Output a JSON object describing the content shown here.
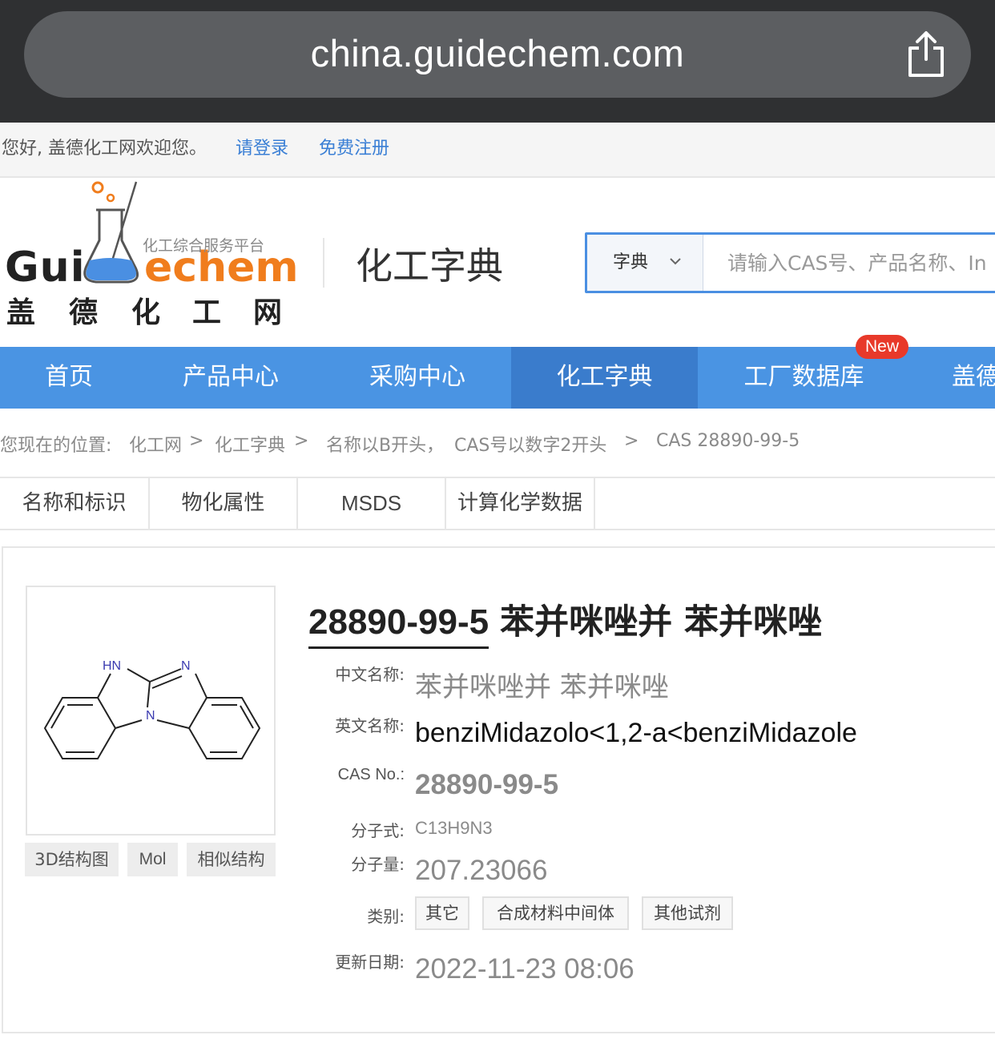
{
  "browser": {
    "url": "china.guidechem.com"
  },
  "welcome": {
    "text": "您好, 盖德化工网欢迎您。",
    "login": "请登录",
    "register": "免费注册"
  },
  "logo": {
    "brand_left": "Gui",
    "brand_right": "echem",
    "tagline": "化工综合服务平台",
    "chars": [
      "盖",
      "德",
      "化",
      "工",
      "网"
    ]
  },
  "header": {
    "title": "化工字典"
  },
  "search": {
    "select": "字典",
    "placeholder": "请输入CAS号、产品名称、In"
  },
  "nav": {
    "items": [
      "首页",
      "产品中心",
      "采购中心",
      "化工字典",
      "工厂数据库",
      "盖德"
    ],
    "active": "化工字典",
    "badge": "New"
  },
  "breadcrumb": {
    "prefix": "您现在的位置:",
    "items": [
      "化工网",
      "化工字典",
      "名称以B开头，",
      "CAS号以数字2开头",
      "CAS 28890-99-5"
    ],
    "sep": ">"
  },
  "tabs": [
    "名称和标识",
    "物化属性",
    "MSDS",
    "计算化学数据"
  ],
  "structure": {
    "atoms": {
      "hn": "HN",
      "n1": "N",
      "n2": "N"
    },
    "buttons": [
      "3D结构图",
      "Mol",
      "相似结构"
    ]
  },
  "compound": {
    "cas": "28890-99-5",
    "title_name": "苯并咪唑并 苯并咪唑",
    "fields": {
      "cn_label": "中文名称:",
      "cn_value": "苯并咪唑并 苯并咪唑",
      "en_label": "英文名称:",
      "en_value": "benziMidazolo<1,2-a<benziMidazole",
      "cas_label": "CAS No.:",
      "cas_value": "28890-99-5",
      "formula_label": "分子式:",
      "formula_value": "C13H9N3",
      "mw_label": "分子量:",
      "mw_value": "207.23066",
      "cat_label": "类别:",
      "categories": [
        "其它",
        "合成材料中间体",
        "其他试剂"
      ],
      "date_label": "更新日期:",
      "date_value": "2022-11-23 08:06"
    }
  },
  "colors": {
    "nav_blue": "#4a94e3",
    "nav_active": "#3a7ccc",
    "link_blue": "#3a7fd5",
    "logo_orange": "#f07d1d",
    "badge_red": "#e8392a"
  }
}
